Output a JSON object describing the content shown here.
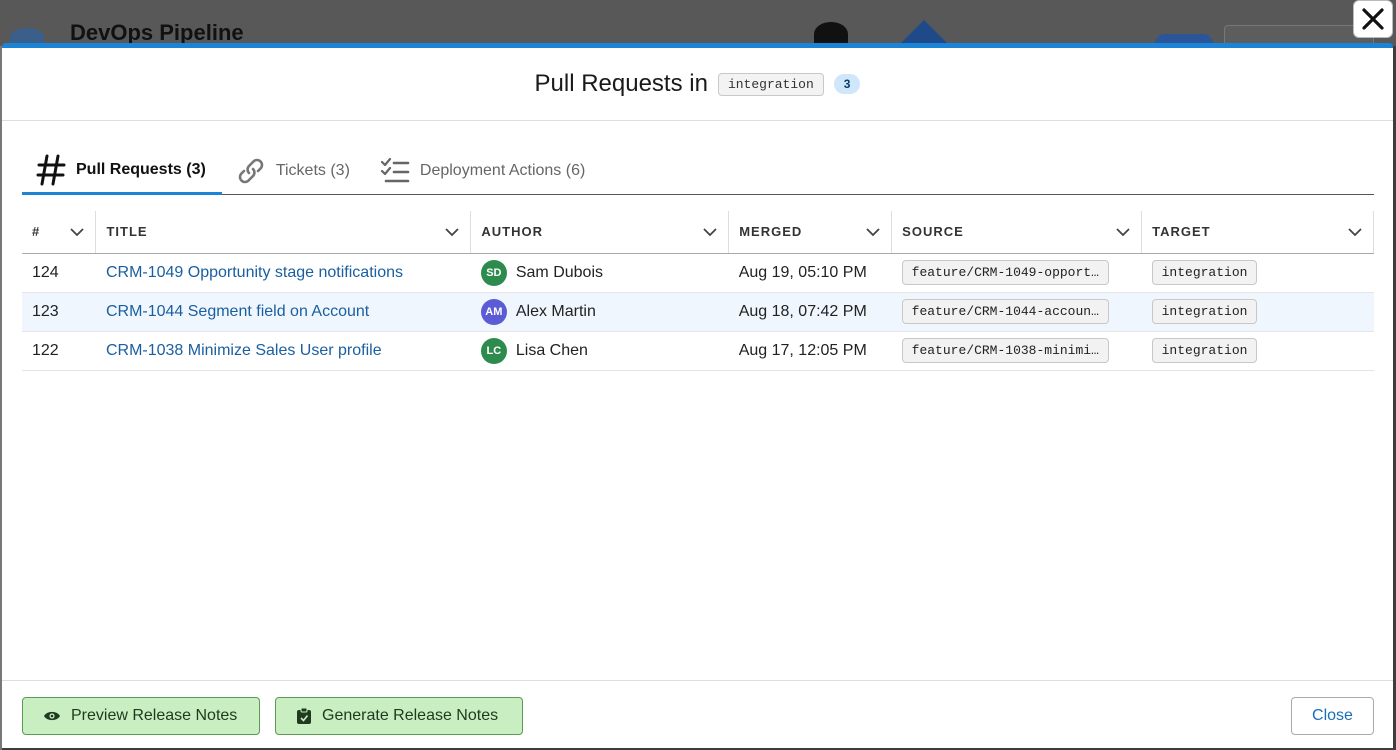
{
  "background": {
    "app_title": "DevOps Pipeline"
  },
  "modal": {
    "title": "Pull Requests in",
    "branch": "integration",
    "count": "3"
  },
  "tabs": [
    {
      "label": "Pull Requests (3)",
      "icon": "hash-icon",
      "active": true
    },
    {
      "label": "Tickets (3)",
      "icon": "link-icon",
      "active": false
    },
    {
      "label": "Deployment Actions (6)",
      "icon": "checklist-icon",
      "active": false
    }
  ],
  "table": {
    "columns": [
      "#",
      "TITLE",
      "AUTHOR",
      "MERGED",
      "SOURCE",
      "TARGET"
    ],
    "rows": [
      {
        "num": "124",
        "title": "CRM-1049 Opportunity stage notifications",
        "initials": "SD",
        "author": "Sam Dubois",
        "avatar_color": "#2e8b4e",
        "merged": "Aug 19, 05:10 PM",
        "source": "feature/CRM-1049-opport…",
        "target": "integration"
      },
      {
        "num": "123",
        "title": "CRM-1044 Segment field on Account",
        "initials": "AM",
        "author": "Alex Martin",
        "avatar_color": "#5b5bd6",
        "merged": "Aug 18, 07:42 PM",
        "source": "feature/CRM-1044-accoun…",
        "target": "integration"
      },
      {
        "num": "122",
        "title": "CRM-1038 Minimize Sales User profile",
        "initials": "LC",
        "author": "Lisa Chen",
        "avatar_color": "#2e8b4e",
        "merged": "Aug 17, 12:05 PM",
        "source": "feature/CRM-1038-minimi…",
        "target": "integration"
      }
    ]
  },
  "footer": {
    "preview_label": "Preview Release Notes",
    "generate_label": "Generate Release Notes",
    "close_label": "Close"
  },
  "colors": {
    "accent": "#1b84d6",
    "link": "#1a5fa0",
    "green_button": "#c9eec2"
  }
}
